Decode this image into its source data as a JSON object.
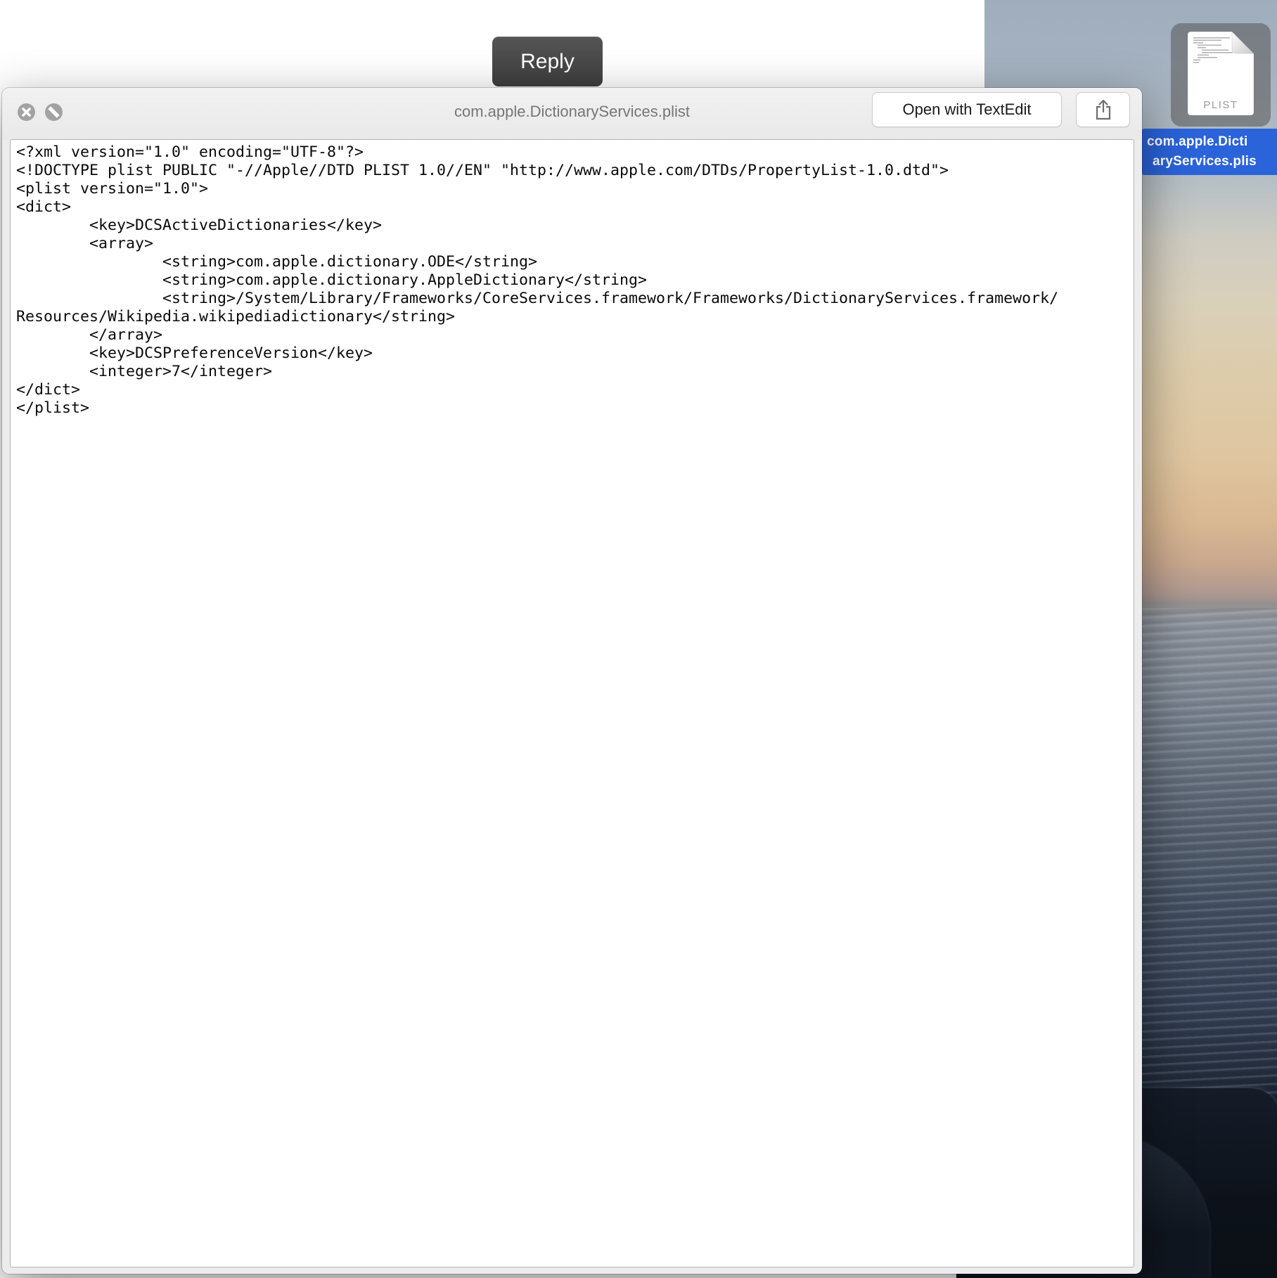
{
  "background_window": {
    "reply_label": "Reply"
  },
  "quicklook": {
    "title": "com.apple.DictionaryServices.plist",
    "toolbar": {
      "open_with_label": "Open with TextEdit"
    },
    "content_lines": [
      "<?xml version=\"1.0\" encoding=\"UTF-8\"?>",
      "<!DOCTYPE plist PUBLIC \"-//Apple//DTD PLIST 1.0//EN\" \"http://www.apple.com/DTDs/PropertyList-1.0.dtd\">",
      "<plist version=\"1.0\">",
      "<dict>",
      "\t<key>DCSActiveDictionaries</key>",
      "\t<array>",
      "\t\t<string>com.apple.dictionary.ODE</string>",
      "\t\t<string>com.apple.dictionary.AppleDictionary</string>",
      "\t\t<string>/System/Library/Frameworks/CoreServices.framework/Frameworks/DictionaryServices.framework/",
      "Resources/Wikipedia.wikipediadictionary</string>",
      "\t</array>",
      "\t<key>DCSPreferenceVersion</key>",
      "\t<integer>7</integer>",
      "</dict>",
      "</plist>"
    ]
  },
  "desktop_icon": {
    "file_type_badge": "PLIST",
    "label_line1": "com.apple.Dicti",
    "label_line2": "aryServices.plis"
  },
  "icons": {
    "close": "circle-with-x",
    "no_entry": "circle-with-diagonal-slash",
    "share": "box-with-up-arrow"
  },
  "colors": {
    "selection_label_blue": "#2a63da",
    "window_chrome": "#ececec",
    "reply_button_bg": "#474747",
    "title_text": "#767676"
  }
}
